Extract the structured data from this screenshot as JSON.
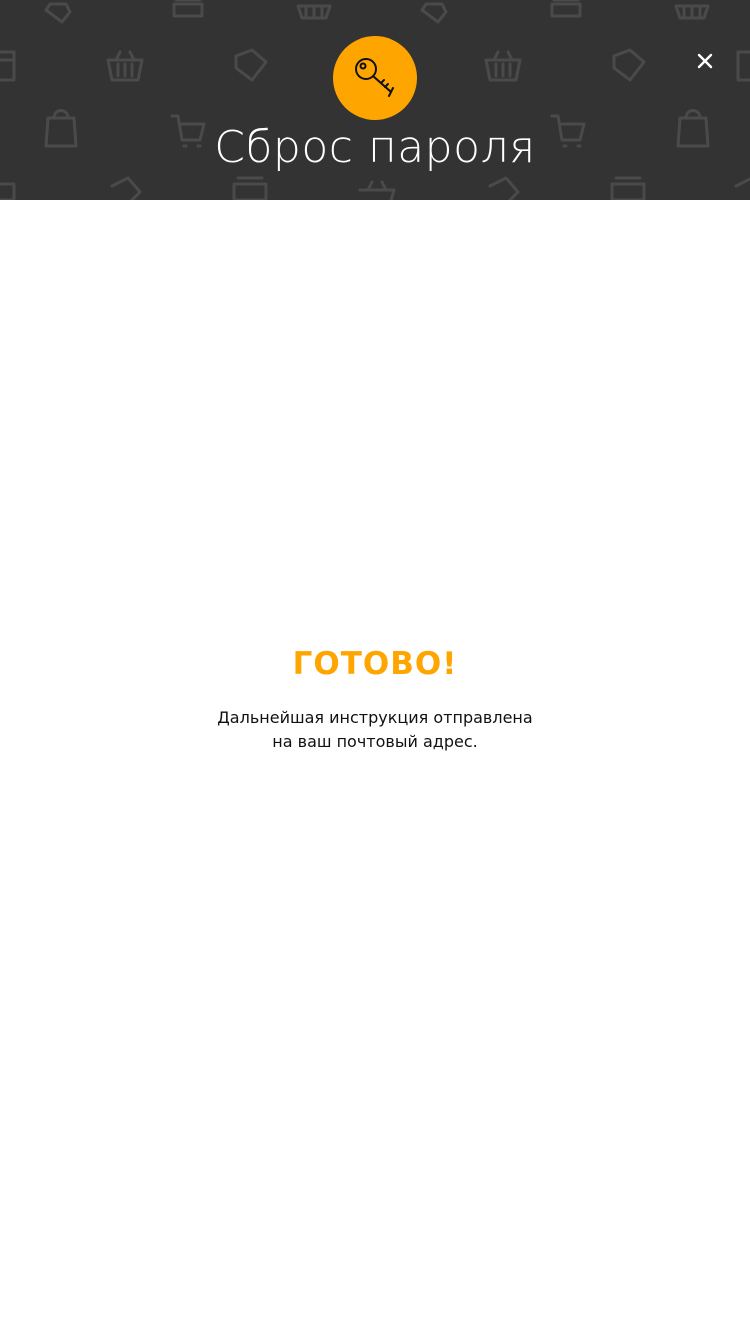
{
  "header": {
    "title": "Сброс пароля",
    "icon": "key-icon",
    "close_icon": "close-icon",
    "background_color": "#333333",
    "accent_color": "#ffa500"
  },
  "message": {
    "title": "ГОТОВО!",
    "line1": "Дальнейшая инструкция отправлена",
    "line2": "на ваш почтовый адрес."
  }
}
